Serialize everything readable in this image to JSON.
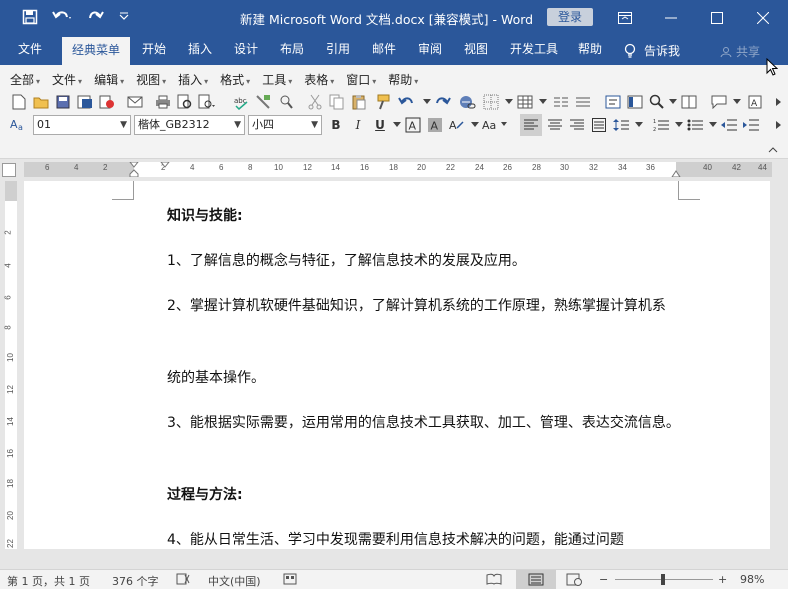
{
  "titlebar": {
    "title": "新建 Microsoft Word 文档.docx [兼容模式] - Word",
    "login": "登录",
    "accent": "#2b579a"
  },
  "tabs": [
    {
      "label": "文件"
    },
    {
      "label": "经典菜单"
    },
    {
      "label": "开始"
    },
    {
      "label": "插入"
    },
    {
      "label": "设计"
    },
    {
      "label": "布局"
    },
    {
      "label": "引用"
    },
    {
      "label": "邮件"
    },
    {
      "label": "审阅"
    },
    {
      "label": "视图"
    },
    {
      "label": "开发工具"
    },
    {
      "label": "帮助"
    }
  ],
  "tell_me": "告诉我",
  "share": "共享",
  "menus": [
    "全部",
    "文件",
    "编辑",
    "视图",
    "插入",
    "格式",
    "工具",
    "表格",
    "窗口",
    "帮助"
  ],
  "format_bar": {
    "style": "01",
    "font": "楷体_GB2312",
    "size": "小四",
    "font_color": "#333333"
  },
  "ruler": {
    "h_numbers": [
      "6",
      "4",
      "2",
      "2",
      "4",
      "6",
      "8",
      "10",
      "12",
      "14",
      "16",
      "18",
      "20",
      "22",
      "24",
      "26",
      "28",
      "30",
      "32",
      "34",
      "36",
      "40",
      "42",
      "44"
    ],
    "v_numbers": [
      "2",
      "4",
      "6",
      "8",
      "10",
      "12",
      "14",
      "16",
      "18",
      "20",
      "22"
    ]
  },
  "document": {
    "p1": "知识与技能:",
    "p2": "1、了解信息的概念与特征，了解信息技术的发展及应用。",
    "p3": "2、掌握计算机软硬件基础知识，了解计算机系统的工作原理，熟练掌握计算机系",
    "p4": "统的基本操作。",
    "p5": "3、能根据实际需要，运用常用的信息技术工具获取、加工、管理、表达交流信息。",
    "p6": "过程与方法:",
    "p7": "4、能从日常生活、学习中发现需要利用信息技术解决的问题，能通过问题"
  },
  "status": {
    "page": "第 1 页，共 1 页",
    "words": "376 个字",
    "lang": "中文(中国)",
    "zoom": "98%",
    "zoom_level": 0.49
  }
}
